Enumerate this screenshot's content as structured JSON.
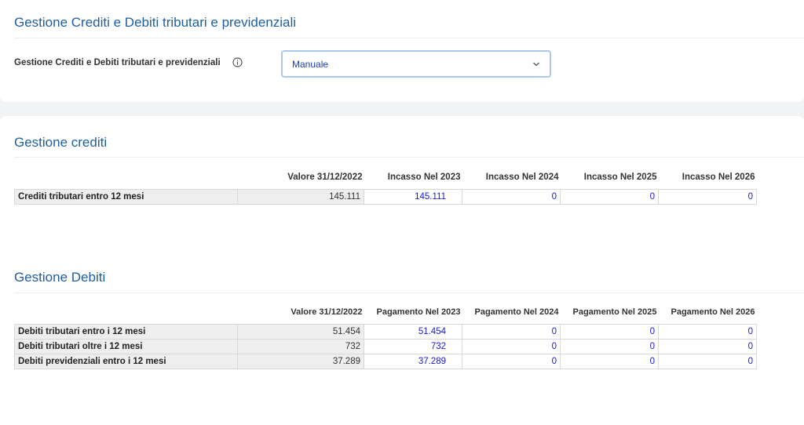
{
  "header": {
    "title": "Gestione Crediti e Debiti tributari e previdenziali"
  },
  "setting": {
    "label": "Gestione Crediti e Debiti tributari e previdenziali",
    "info_icon": "info-circle-icon",
    "select_value": "Manuale",
    "chevron_icon": "chevron-down-icon"
  },
  "crediti": {
    "title": "Gestione crediti",
    "columns": [
      "",
      "Valore 31/12/2022",
      "Incasso Nel 2023",
      "Incasso Nel 2024",
      "Incasso Nel 2025",
      "Incasso Nel 2026"
    ],
    "rows": [
      {
        "label": "Crediti tributari entro 12 mesi",
        "valore": "145.111",
        "y1": "145.111",
        "y2": "0",
        "y3": "0",
        "y4": "0"
      }
    ]
  },
  "debiti": {
    "title": "Gestione Debiti",
    "columns": [
      "",
      "Valore 31/12/2022",
      "Pagamento Nel 2023",
      "Pagamento Nel 2024",
      "Pagamento Nel 2025",
      "Pagamento Nel 2026"
    ],
    "rows": [
      {
        "label": "Debiti tributari entro i 12 mesi",
        "valore": "51.454",
        "y1": "51.454",
        "y2": "0",
        "y3": "0",
        "y4": "0"
      },
      {
        "label": "Debiti tributari oltre i 12 mesi",
        "valore": "732",
        "y1": "732",
        "y2": "0",
        "y3": "0",
        "y4": "0"
      },
      {
        "label": "Debiti previdenziali entro i 12 mesi",
        "valore": "37.289",
        "y1": "37.289",
        "y2": "0",
        "y3": "0",
        "y4": "0"
      }
    ]
  },
  "colors": {
    "accent": "#1f5e9e",
    "input_text": "#1a1ad6",
    "select_border": "#a9c9ec"
  }
}
